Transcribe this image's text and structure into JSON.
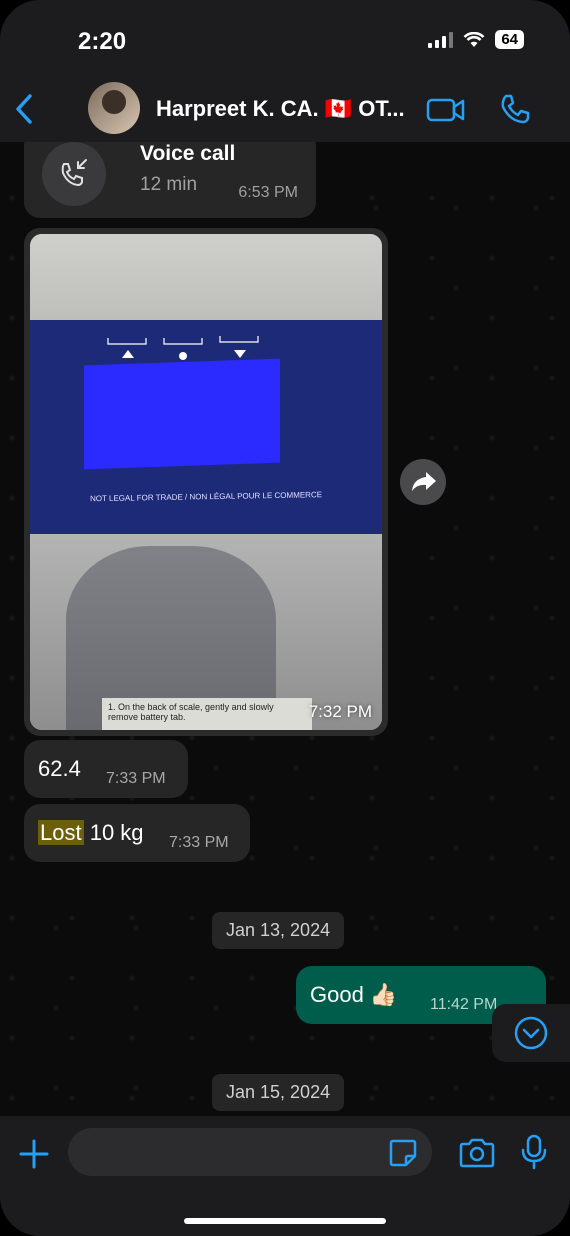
{
  "status_bar": {
    "time": "2:20",
    "battery": "64"
  },
  "header": {
    "contact_name": "Harpreet K. CA. 🇨🇦 OT..."
  },
  "messages": {
    "voice_call": {
      "title": "Voice call",
      "duration": "12 min",
      "time": "6:53 PM"
    },
    "photo": {
      "time": "7:32 PM",
      "image_text_legal": "NOT LEGAL FOR TRADE / NON LÉGAL POUR LE COMMERCE",
      "image_text_sticker": "1. On the back of scale, gently and slowly remove battery tab."
    },
    "msg_624": {
      "text": "62.4",
      "time": "7:33 PM"
    },
    "msg_lost": {
      "highlight": "Lost",
      "rest": " 10 kg",
      "time": "7:33 PM"
    },
    "date_jan13": "Jan 13, 2024",
    "msg_good": {
      "text": "Good 👍🏻",
      "time": "11:42 PM"
    },
    "date_jan15": "Jan 15, 2024"
  },
  "input": {
    "placeholder": ""
  },
  "colors": {
    "accent": "#25a0f5",
    "outgoing_bubble": "#005c4b",
    "incoming_bubble": "#262626",
    "highlight": "#6b5f0b"
  }
}
